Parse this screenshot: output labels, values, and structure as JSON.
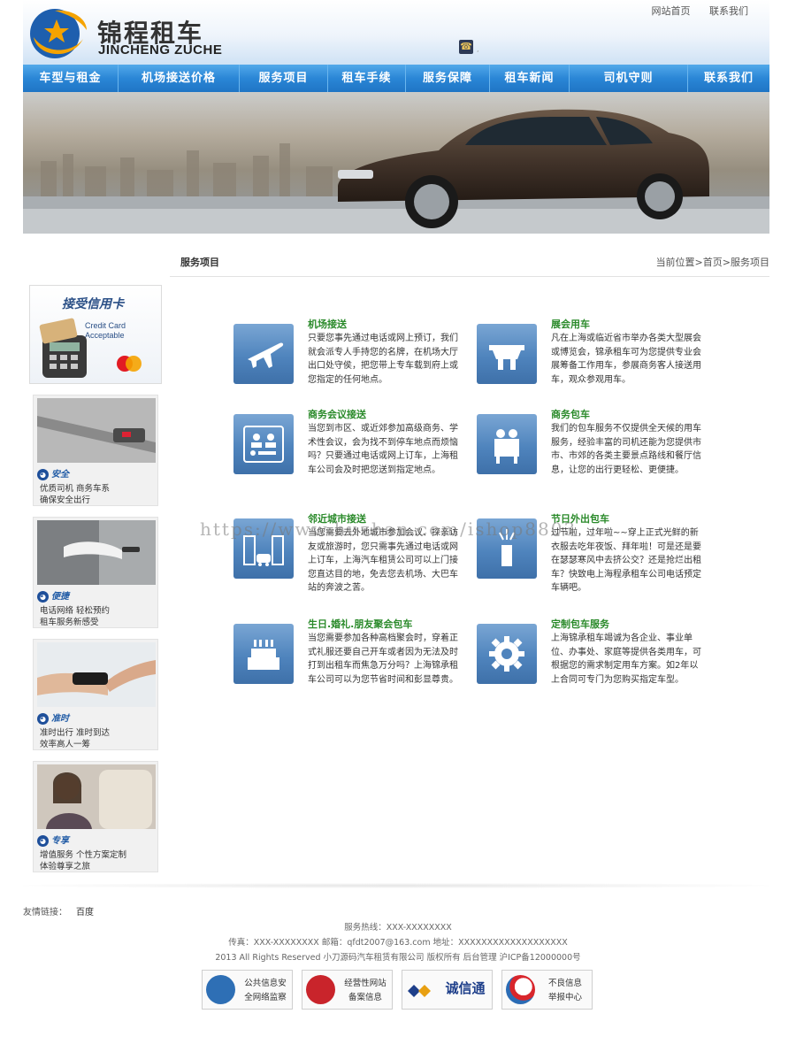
{
  "header": {
    "logo_cn": "锦程租车",
    "logo_en": "JINCHENG ZUCHE",
    "top_links": [
      "网站首页",
      "联系我们"
    ]
  },
  "nav": [
    "车型与租金",
    "机场接送价格",
    "服务项目",
    "租车手续",
    "服务保障",
    "租车新闻",
    "司机守则",
    "联系我们"
  ],
  "content": {
    "section_title": "服务项目",
    "breadcrumb": "当前位置>首页>服务项目"
  },
  "sidebar": {
    "credit_title": "接受信用卡",
    "credit_en_1": "Credit Card",
    "credit_en_2": "Acceptable",
    "boxes": [
      {
        "tag": "安全",
        "line1": "优质司机  商务车系",
        "line2": "确保安全出行"
      },
      {
        "tag": "便捷",
        "line1": "电话网络  轻松预约",
        "line2": "租车服务新感受"
      },
      {
        "tag": "准时",
        "line1": "准时出行  准时到达",
        "line2": "效率高人一筹"
      },
      {
        "tag": "专享",
        "line1": "增值服务  个性方案定制",
        "line2": "体验尊享之旅"
      }
    ]
  },
  "services": [
    {
      "title": "机场接送",
      "icon": "airplane-icon",
      "text": "只要您事先通过电话或网上预订，我们就会派专人手持您的名牌，在机场大厅出口处守侯，把您带上专车载到府上或您指定的任何地点。"
    },
    {
      "title": "展会用车",
      "icon": "exhibition-icon",
      "text": "凡在上海或临近省市举办各类大型展会或博览会，锦承租车可为您提供专业会展筹备工作用车，参展商务客人接送用车，观众参观用车。"
    },
    {
      "title": "商务会议接送",
      "icon": "meeting-icon",
      "text": "当您到市区、或近郊参加高级商务、学术性会议，会为找不到停车地点而烦恼吗？只要通过电话或网上订车，上海租车公司会及时把您送到指定地点。"
    },
    {
      "title": "商务包车",
      "icon": "business-people-icon",
      "text": "我们的包车服务不仅提供全天候的用车服务，经验丰富的司机还能为您提供市市、市郊的各类主要景点路线和餐厅信息，让您的出行更轻松、更便捷。"
    },
    {
      "title": "邻近城市接送",
      "icon": "city-icon",
      "text": "当您需要去外地城市参加会议、探亲访友或旅游时，您只需事先通过电话或网上订车，上海汽车租赁公司可以上门接您直达目的地，免去您去机场、大巴车站的奔波之苦。"
    },
    {
      "title": "节日外出包车",
      "icon": "firework-icon",
      "text": "过节啦，过年啦~~穿上正式光鲜的新衣服去吃年夜饭、拜年啦！可是还是要在瑟瑟寒风中去挤公交？还是抢烂出租车？快致电上海程承租车公司电话预定车辆吧。"
    },
    {
      "title": "生日.婚礼.朋友聚会包车",
      "icon": "cake-icon",
      "text": "当您需要参加各种高档聚会时，穿着正式礼服还要自己开车或者因为无法及时打到出租车而焦急万分吗？上海锦承租车公司可以为您节省时间和彭显尊贵。"
    },
    {
      "title": "定制包车服务",
      "icon": "gear-icon",
      "text": "上海锦承租车竭诚为各企业、事业单位、办事处、家庭等提供各类用车，可根据您的需求制定用车方案。如2年以上合同可专门为您购买指定车型。"
    }
  ],
  "watermark": "https://www.huzhan.com/ishop8803",
  "footer": {
    "friend_label": "友情链接：",
    "friend_link": "百度",
    "hotline": "服务热线：XXX-XXXXXXXX",
    "contact": "传真：XXX-XXXXXXXX   邮箱：qfdt2007@163.com   地址：XXXXXXXXXXXXXXXXXXX",
    "copyright": "2013 All Rights Reserved  小刀源码汽车租赁有限公司 版权所有   后台管理   沪ICP备12000000号",
    "badges": [
      {
        "line1": "公共信息安",
        "line2": "全网络监察"
      },
      {
        "line1": "经营性网站",
        "line2": "备案信息"
      },
      {
        "line1": "诚信通",
        "line2": ""
      },
      {
        "line1": "不良信息",
        "line2": "举报中心"
      }
    ]
  },
  "colors": {
    "nav_blue": "#2a86d6",
    "service_title_green": "#2a8a2a",
    "icon_blue": "#4f84bd",
    "sidebar_tag_blue": "#1f5aa5"
  }
}
